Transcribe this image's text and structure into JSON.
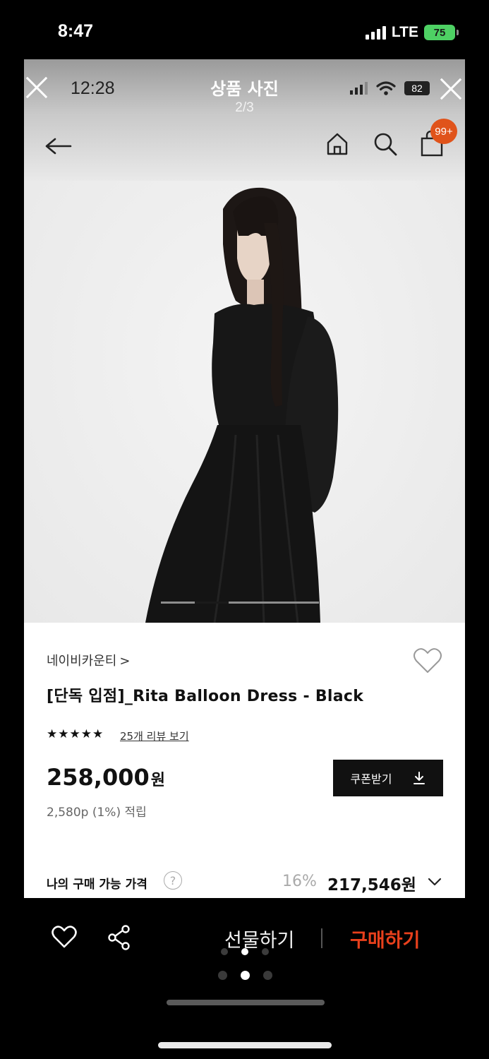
{
  "outer_status": {
    "time": "8:47",
    "network": "LTE",
    "battery": "75"
  },
  "viewer": {
    "time": "12:28",
    "title": "상품 사진",
    "counter": "2/3",
    "battery": "82"
  },
  "nav": {
    "cart_badge": "99+"
  },
  "product": {
    "brand": "네이비카운티",
    "brand_chevron": ">",
    "name": "[단독 입점]_Rita Balloon Dress - Black",
    "rating_stars": 5,
    "stars_text": "★★★★★",
    "review_link": "25개 리뷰 보기",
    "price": "258,000",
    "price_unit": "원",
    "points": "2,580p (1%) 적립",
    "coupon_label": "쿠폰받기",
    "my_price_label": "나의 구매 가능 가격",
    "help_glyph": "?",
    "discount": "16%",
    "final_price": "217,546원"
  },
  "bottom_bar": {
    "gift_label": "선물하기",
    "buy_label": "구매하기"
  },
  "colors": {
    "accent": "#e8401c",
    "badge": "#e0531a",
    "battery_green": "#4ed164"
  },
  "pager": {
    "total": 3,
    "current_index": 1
  }
}
